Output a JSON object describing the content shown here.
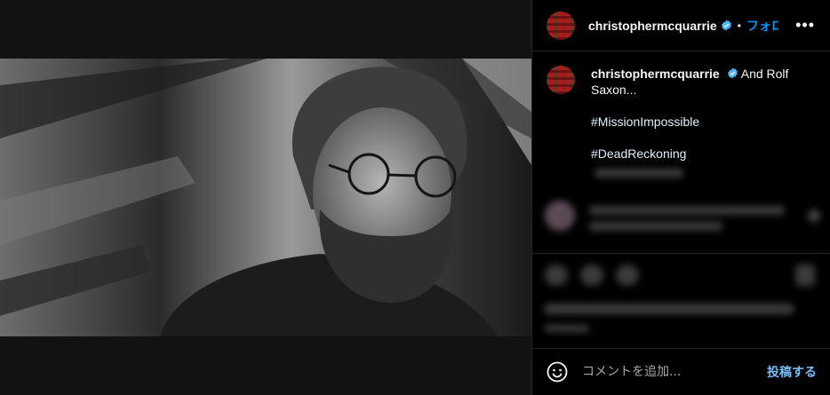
{
  "header": {
    "username": "christophermcquarrie",
    "separator": "•",
    "follow_label": "フォロー",
    "more_label": "•••"
  },
  "caption": {
    "username": "christophermcquarrie",
    "text": "And Rolf Saxon...",
    "hashtags": [
      "#MissionImpossible",
      "#DeadReckoning"
    ]
  },
  "comment": {
    "placeholder": "コメントを追加...",
    "post_label": "投稿する"
  },
  "icons": {
    "verified": "verified-badge-icon",
    "emoji": "emoji-smile-icon",
    "more": "more-options-icon"
  },
  "colors": {
    "accent": "#0095f6",
    "post_button": "#74bdf7",
    "verified": "#4db5f9"
  }
}
